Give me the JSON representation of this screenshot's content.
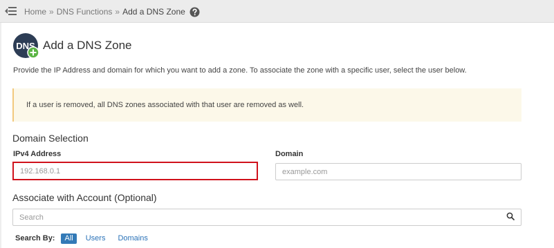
{
  "breadcrumb": {
    "items": [
      {
        "label": "Home"
      },
      {
        "label": "DNS Functions"
      }
    ],
    "separator": "»",
    "current": "Add a DNS Zone"
  },
  "icons": {
    "menu_toggle": "menu-collapse-icon",
    "help": "help-circle-icon",
    "page": "dns-add-icon",
    "search": "search-icon"
  },
  "page": {
    "icon_text": "DNS",
    "title": "Add a DNS Zone",
    "description": "Provide the IP Address and domain for which you want to add a zone. To associate the zone with a specific user, select the user below."
  },
  "alert": {
    "text": "If a user is removed, all DNS zones associated with that user are removed as well."
  },
  "domain_selection": {
    "title": "Domain Selection",
    "ipv4_label": "IPv4 Address",
    "ipv4_placeholder": "192.168.0.1",
    "domain_label": "Domain",
    "domain_placeholder": "example.com"
  },
  "account": {
    "title": "Associate with Account (Optional)",
    "search_placeholder": "Search",
    "search_by_label": "Search By:",
    "filters": [
      {
        "label": "All",
        "active": true
      },
      {
        "label": "Users",
        "active": false
      },
      {
        "label": "Domains",
        "active": false
      }
    ]
  },
  "colors": {
    "accent": "#337ab7",
    "link": "#2a72b8",
    "alert_background": "#fcf8e9",
    "alert_border": "#f2c97d",
    "highlight": "#d0111b",
    "icon_circle": "#2d3d55",
    "icon_badge": "#5bb544"
  }
}
